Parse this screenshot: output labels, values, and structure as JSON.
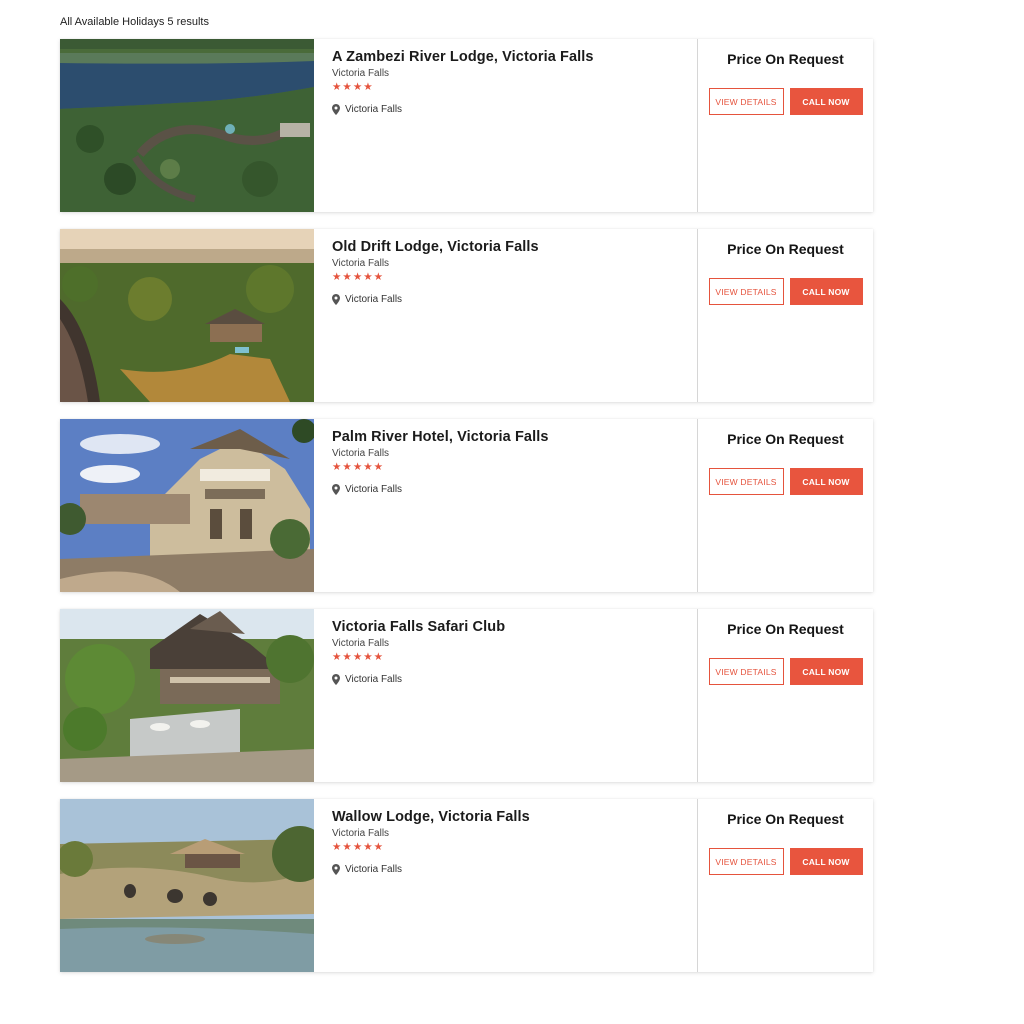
{
  "results": {
    "header": "All Available Holidays 5 results"
  },
  "listings": [
    {
      "name": "A Zambezi River Lodge, Victoria Falls",
      "subtitle": "Victoria Falls",
      "stars": "★★★★",
      "location": "Victoria Falls",
      "price": "Price On Request",
      "view_label": "VIEW DETAILS",
      "call_label": "CALL NOW"
    },
    {
      "name": "Old Drift Lodge, Victoria Falls",
      "subtitle": "Victoria Falls",
      "stars": "★★★★★",
      "location": "Victoria Falls",
      "price": "Price On Request",
      "view_label": "VIEW DETAILS",
      "call_label": "CALL NOW"
    },
    {
      "name": "Palm River Hotel, Victoria Falls",
      "subtitle": "Victoria Falls",
      "stars": "★★★★★",
      "location": "Victoria Falls",
      "price": "Price On Request",
      "view_label": "VIEW DETAILS",
      "call_label": "CALL NOW"
    },
    {
      "name": "Victoria Falls Safari Club",
      "subtitle": "Victoria Falls",
      "stars": "★★★★★",
      "location": "Victoria Falls",
      "price": "Price On Request",
      "view_label": "VIEW DETAILS",
      "call_label": "CALL NOW"
    },
    {
      "name": "Wallow Lodge, Victoria Falls",
      "subtitle": "Victoria Falls",
      "stars": "★★★★★",
      "location": "Victoria Falls",
      "price": "Price On Request",
      "view_label": "VIEW DETAILS",
      "call_label": "CALL NOW"
    }
  ],
  "colors": {
    "accent": "#e5533d",
    "star": "#e5533d",
    "text": "#1a1a1a",
    "divider": "#d6d6d6"
  },
  "icons": {
    "location": "map-pin-icon"
  }
}
